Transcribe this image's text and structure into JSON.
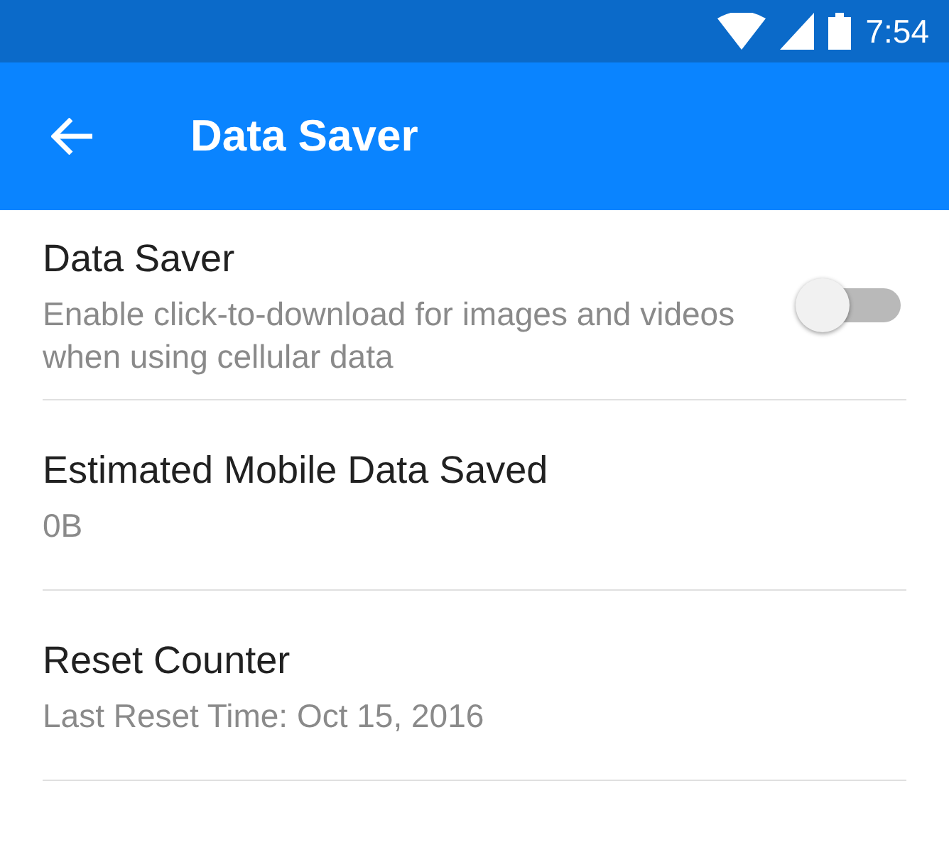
{
  "status_bar": {
    "time": "7:54"
  },
  "app_bar": {
    "title": "Data Saver"
  },
  "settings": [
    {
      "kind": "toggle",
      "title": "Data Saver",
      "summary": "Enable click-to-download for images and videos when using cellular data",
      "on": false
    },
    {
      "kind": "info",
      "title": "Estimated Mobile Data Saved",
      "summary": "0B"
    },
    {
      "kind": "info",
      "title": "Reset Counter",
      "summary": "Last Reset Time: Oct 15, 2016"
    }
  ]
}
